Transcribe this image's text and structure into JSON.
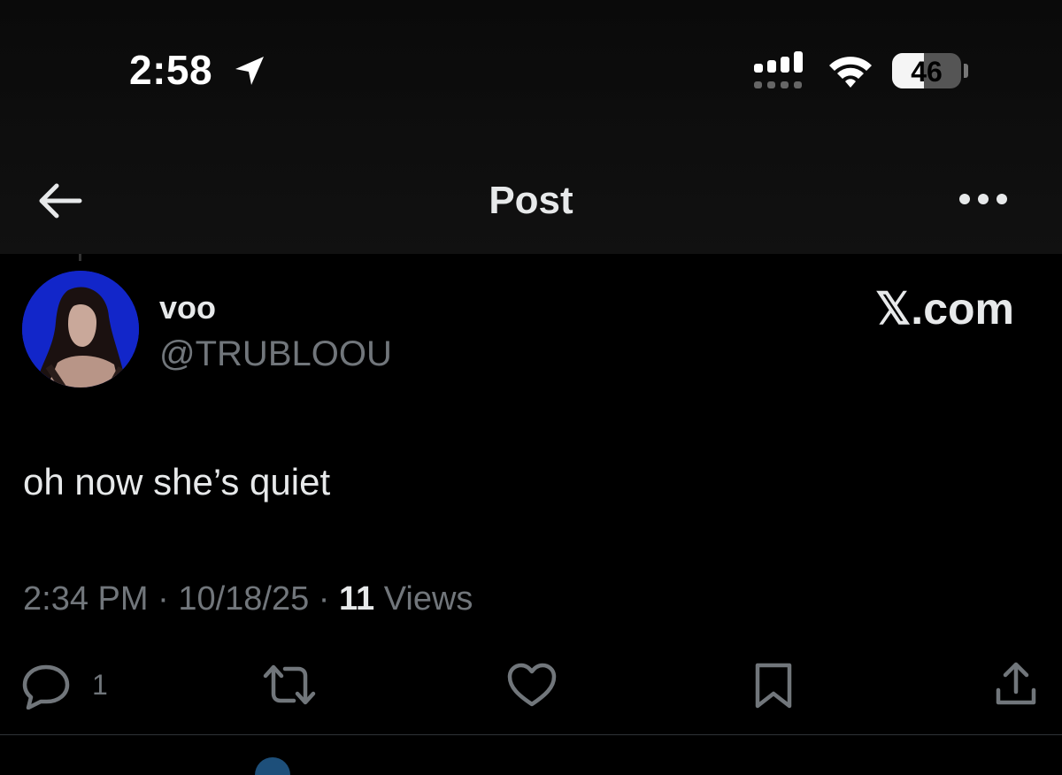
{
  "status_bar": {
    "time": "2:58",
    "battery_level": "46",
    "battery_fraction": 0.46,
    "icons": [
      "location-arrow-icon",
      "cellular-signal-icon",
      "wifi-icon",
      "battery-icon"
    ]
  },
  "header": {
    "title": "Post",
    "back_icon": "arrow-left-icon",
    "more_icon": "more-horizontal-icon"
  },
  "post": {
    "display_name": "voo",
    "handle": "@TRUBLOOU",
    "source_label": "𝕏.com",
    "text": "oh now she’s quiet",
    "time": "2:34 PM",
    "separator": " · ",
    "date": "10/18/25",
    "views_count": "11",
    "views_label": " Views",
    "avatar_bg": "#1226c9"
  },
  "actions": {
    "reply_count": "1",
    "icons": [
      "reply-icon",
      "repost-icon",
      "like-icon",
      "bookmark-icon",
      "share-icon"
    ]
  },
  "colors": {
    "background": "#000000",
    "text_primary": "#e7e9ea",
    "text_secondary": "#71767b",
    "divider": "#2f3336"
  }
}
